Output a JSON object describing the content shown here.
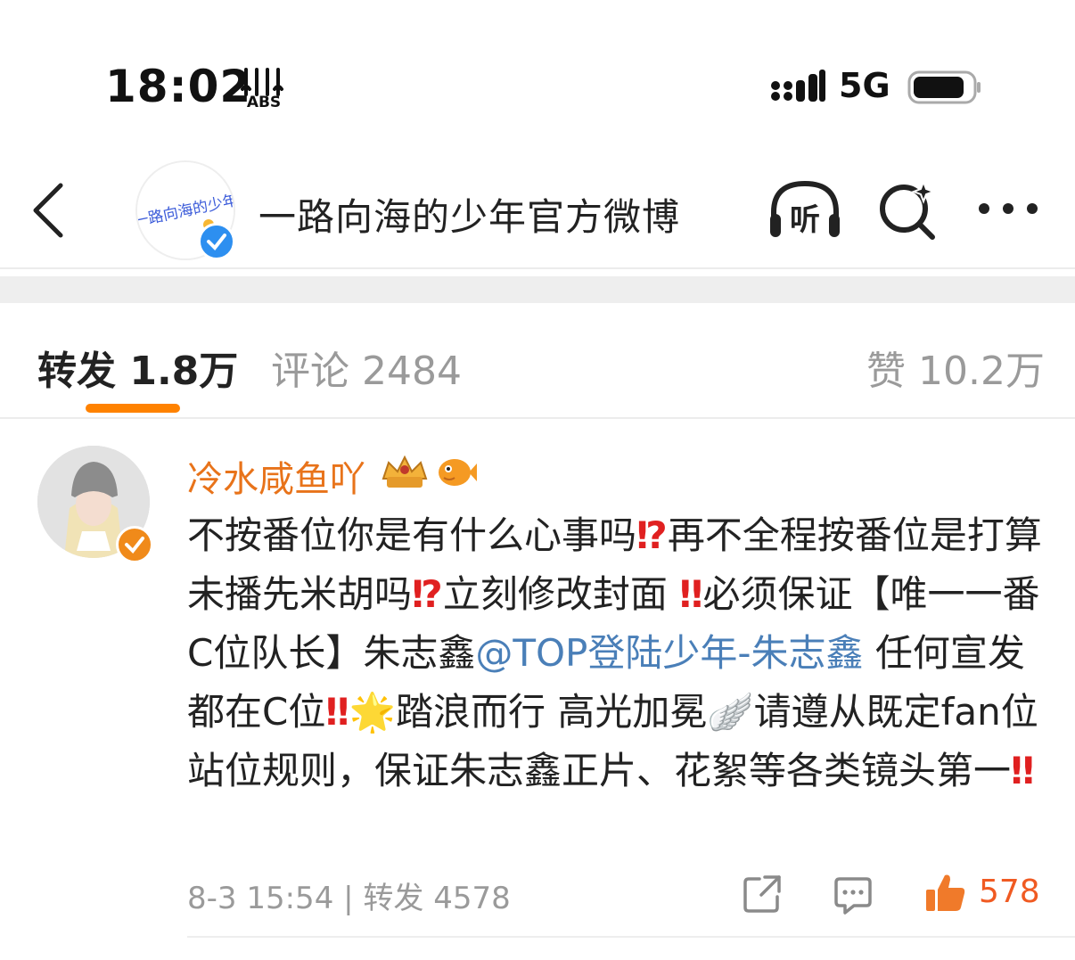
{
  "status_bar": {
    "time": "18:02",
    "badge_text": "ABS",
    "network": "5G",
    "battery_level": 0.85
  },
  "header": {
    "account_name": "一路向海的少年官方微博",
    "listen_label": "听",
    "avatar_logo_text": "一路向海的少年"
  },
  "tabs": {
    "repost": {
      "label": "转发",
      "count": "1.8万"
    },
    "comment": {
      "label": "评论",
      "count": "2484"
    },
    "like": {
      "label": "赞",
      "count": "10.2万"
    }
  },
  "comment": {
    "username": "冷水咸鱼吖",
    "segments": [
      "不按番位你是有什么心事吗",
      "⁉",
      "再不全程按番位是打算未播先米胡吗",
      "⁉",
      "立刻修改封面",
      "‼",
      "必须保证【唯一一番C位队长】朱志鑫",
      "@TOP登陆少年-朱志鑫",
      "任何宣发都在C位",
      "‼",
      "🌟",
      "踏浪而行 高光加冕",
      "🪽",
      "请遵从既定fan位站位规则，保证朱志鑫正片、花絮等各类镜头第一",
      "‼"
    ],
    "date": "8-3 15:54",
    "separator": "|",
    "repost_label": "转发 4578",
    "like_count": "578"
  },
  "colors": {
    "accent_orange": "#ff8200",
    "username_orange": "#e8731a",
    "mention_blue": "#4a7fb8",
    "like_orange": "#f05a22",
    "verified_blue": "#2d8ff0",
    "verified_orange": "#f08a1a"
  },
  "icons": [
    "back-chevron-icon",
    "headphones-listen-icon",
    "search-sparkle-icon",
    "more-dots-icon",
    "share-icon",
    "comment-bubble-icon",
    "thumbs-up-icon",
    "signal-icon",
    "battery-icon"
  ]
}
